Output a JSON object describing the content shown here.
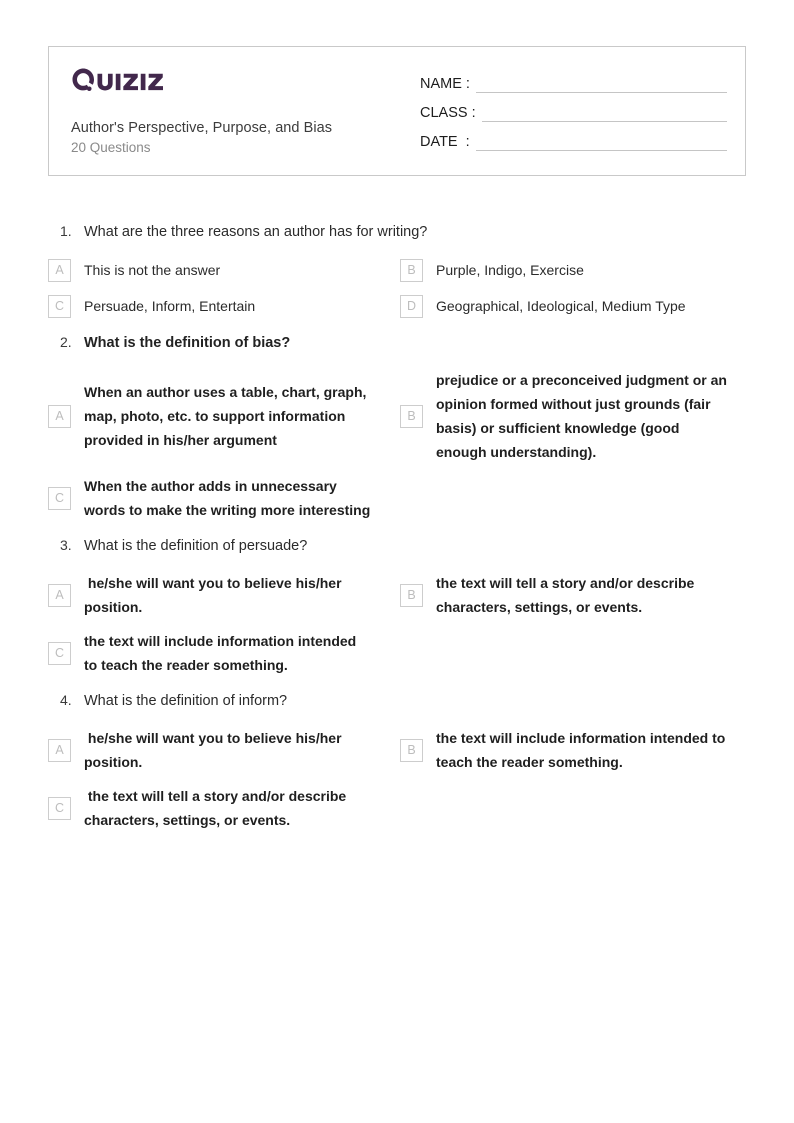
{
  "brand": {
    "logo_text": "Quizizz",
    "logo_color": "#42284c"
  },
  "header": {
    "quiz_title": "Author's Perspective, Purpose, and Bias",
    "question_count_label": "20 Questions",
    "fields": [
      {
        "label": "NAME :",
        "value": ""
      },
      {
        "label": "CLASS :",
        "value": ""
      },
      {
        "label": "DATE  :",
        "value": ""
      }
    ]
  },
  "questions": [
    {
      "number": "1.",
      "text": "What are the three reasons an author has for writing?",
      "bold_question": false,
      "bold_options": false,
      "options": [
        {
          "letter": "A",
          "text": "This is not the answer"
        },
        {
          "letter": "B",
          "text": "Purple, Indigo, Exercise"
        },
        {
          "letter": "C",
          "text": "Persuade, Inform, Entertain"
        },
        {
          "letter": "D",
          "text": "Geographical, Ideological, Medium Type"
        }
      ]
    },
    {
      "number": "2.",
      "text": "What is the definition of bias?",
      "bold_question": true,
      "bold_options": true,
      "options": [
        {
          "letter": "A",
          "text": "When an author uses a table, chart, graph, map, photo, etc. to support information provided in his/her argument"
        },
        {
          "letter": "B",
          "text": "prejudice or a preconceived judgment or an opinion formed without just grounds (fair basis) or sufficient knowledge (good enough understanding)."
        },
        {
          "letter": "C",
          "text": "When the author adds in unnecessary words to make the writing more interesting"
        }
      ]
    },
    {
      "number": "3.",
      "text": "What is the definition of persuade?",
      "bold_question": false,
      "bold_options": true,
      "options": [
        {
          "letter": "A",
          "text": " he/she will want you to believe his/her position."
        },
        {
          "letter": "B",
          "text": "the text will tell a story and/or describe characters, settings, or events."
        },
        {
          "letter": "C",
          "text": "the text will include information intended to teach the reader something."
        }
      ]
    },
    {
      "number": "4.",
      "text": "What is the definition of inform?",
      "bold_question": false,
      "bold_options": true,
      "options": [
        {
          "letter": "A",
          "text": " he/she will want you to believe his/her position."
        },
        {
          "letter": "B",
          "text": "the text will include information intended to teach the reader something."
        },
        {
          "letter": "C",
          "text": " the text will tell a story and/or describe characters, settings, or events."
        }
      ]
    }
  ]
}
